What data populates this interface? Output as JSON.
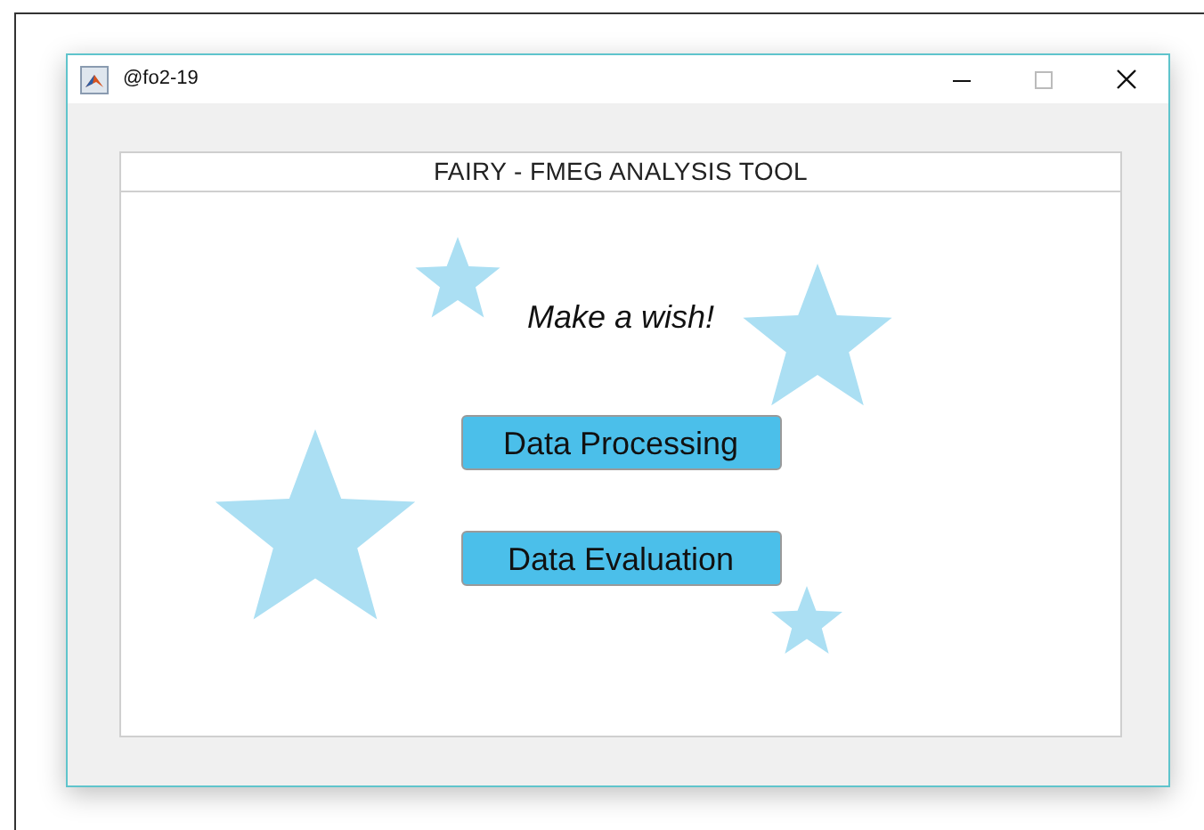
{
  "window": {
    "title": "@fo2-19"
  },
  "panel": {
    "title": "FAIRY - FMEG ANALYSIS TOOL",
    "prompt": "Make a wish!"
  },
  "buttons": [
    "Data Processing",
    "Data Evaluation"
  ]
}
